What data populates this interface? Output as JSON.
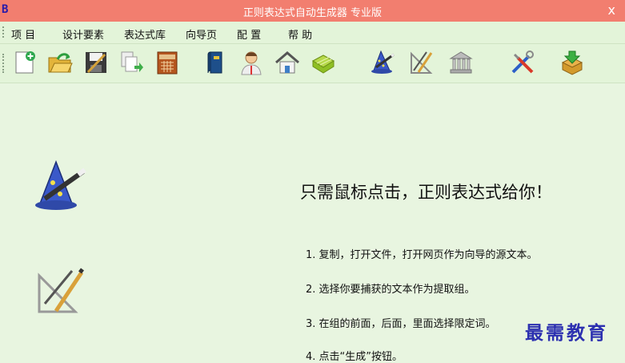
{
  "window": {
    "title": "正则表达式自动生成器 专业版",
    "icon_glyph": "B",
    "close_glyph": "x"
  },
  "menu": {
    "items": [
      {
        "label": "项  目"
      },
      {
        "label": "设计要素"
      },
      {
        "label": "表达式库"
      },
      {
        "label": "向导页"
      },
      {
        "label": "配  置"
      },
      {
        "label": "帮  助"
      }
    ]
  },
  "toolbar": {
    "buttons": [
      {
        "icon": "new-file-icon"
      },
      {
        "icon": "open-folder-icon"
      },
      {
        "icon": "save-icon"
      },
      {
        "icon": "copy-export-icon"
      },
      {
        "icon": "calendar-icon"
      },
      {
        "icon": "book-icon"
      },
      {
        "icon": "user-doctor-icon"
      },
      {
        "icon": "home-icon"
      },
      {
        "icon": "basket-icon"
      },
      {
        "icon": "wizard-hat-icon"
      },
      {
        "icon": "drafting-tools-icon"
      },
      {
        "icon": "bank-icon"
      },
      {
        "icon": "tools-icon"
      },
      {
        "icon": "package-download-icon"
      }
    ]
  },
  "main": {
    "headline": "只需鼠标点击，正则表达式给你！",
    "steps": [
      "1. 复制，打开文件，打开网页作为向导的源文本。",
      "2. 选择你要捕获的文本作为提取组。",
      "3. 在组的前面，后面，里面选择限定词。",
      "4. 点击“生成”按钮。"
    ],
    "watermark": "最需教育"
  },
  "colors": {
    "titlebar": "#f27e6f",
    "background": "#e8f5e0",
    "watermark": "#2c30b0"
  }
}
